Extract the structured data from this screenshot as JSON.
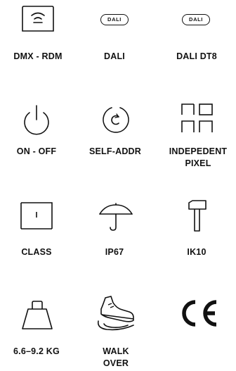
{
  "grid": {
    "row1": [
      {
        "icon": "dmx-rdm-icon",
        "label": "DMX - RDM"
      },
      {
        "icon": "dali-badge-icon",
        "badge_text": "DALI",
        "label": "DALI"
      },
      {
        "icon": "dali-badge-icon",
        "badge_text": "DALI",
        "label": "DALI DT8"
      }
    ],
    "row2": [
      {
        "icon": "power-icon",
        "label": "ON - OFF"
      },
      {
        "icon": "self-addressing-icon",
        "label": "SELF-ADDR"
      },
      {
        "icon": "pixel-grid-icon",
        "label_line1": "INDEPEDENT",
        "label_line2": "PIXEL"
      }
    ],
    "row3": [
      {
        "icon": "class-icon",
        "label": "CLASS"
      },
      {
        "icon": "umbrella-icon",
        "label": "IP67"
      },
      {
        "icon": "hammer-icon",
        "label": "IK10"
      }
    ],
    "row4": [
      {
        "icon": "weight-icon",
        "label": "6.6–9.2 KG"
      },
      {
        "icon": "shoe-icon",
        "label_line1": "WALK",
        "label_line2": "OVER"
      },
      {
        "icon": "ce-mark-icon",
        "label": ""
      }
    ]
  }
}
